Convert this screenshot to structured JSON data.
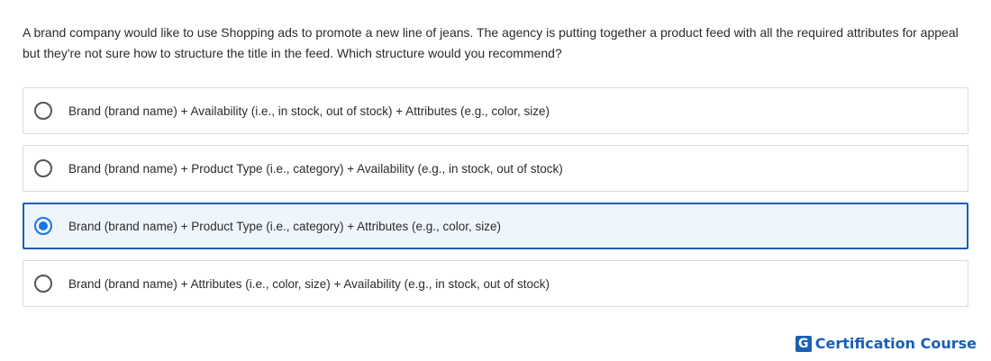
{
  "question": {
    "text": "A brand company would like to use Shopping ads to promote a new line of jeans. The agency is putting together a product feed with all the required attributes for appeal but they're not sure how to structure the title in the feed. Which structure would you recommend?"
  },
  "options": [
    {
      "label": "Brand (brand name) + Availability (i.e., in stock, out of stock) + Attributes (e.g., color, size)",
      "selected": false
    },
    {
      "label": "Brand (brand name) + Product Type (i.e., category) + Availability (e.g., in stock, out of stock)",
      "selected": false
    },
    {
      "label": "Brand (brand name) + Product Type (i.e., category) + Attributes (e.g., color, size)",
      "selected": true
    },
    {
      "label": "Brand (brand name) + Attributes (i.e., color, size) + Availability (e.g., in stock, out of stock)",
      "selected": false
    }
  ],
  "brand": {
    "logo_letter": "G",
    "name": "Certification Course"
  },
  "colors": {
    "accent": "#1a5fb4",
    "radio_selected": "#1a73e8",
    "selected_bg": "#eef5fd",
    "border": "#dcdcdc"
  },
  "icons": {
    "radio_unselected": "radio-unselected-icon",
    "radio_selected": "radio-selected-icon"
  }
}
